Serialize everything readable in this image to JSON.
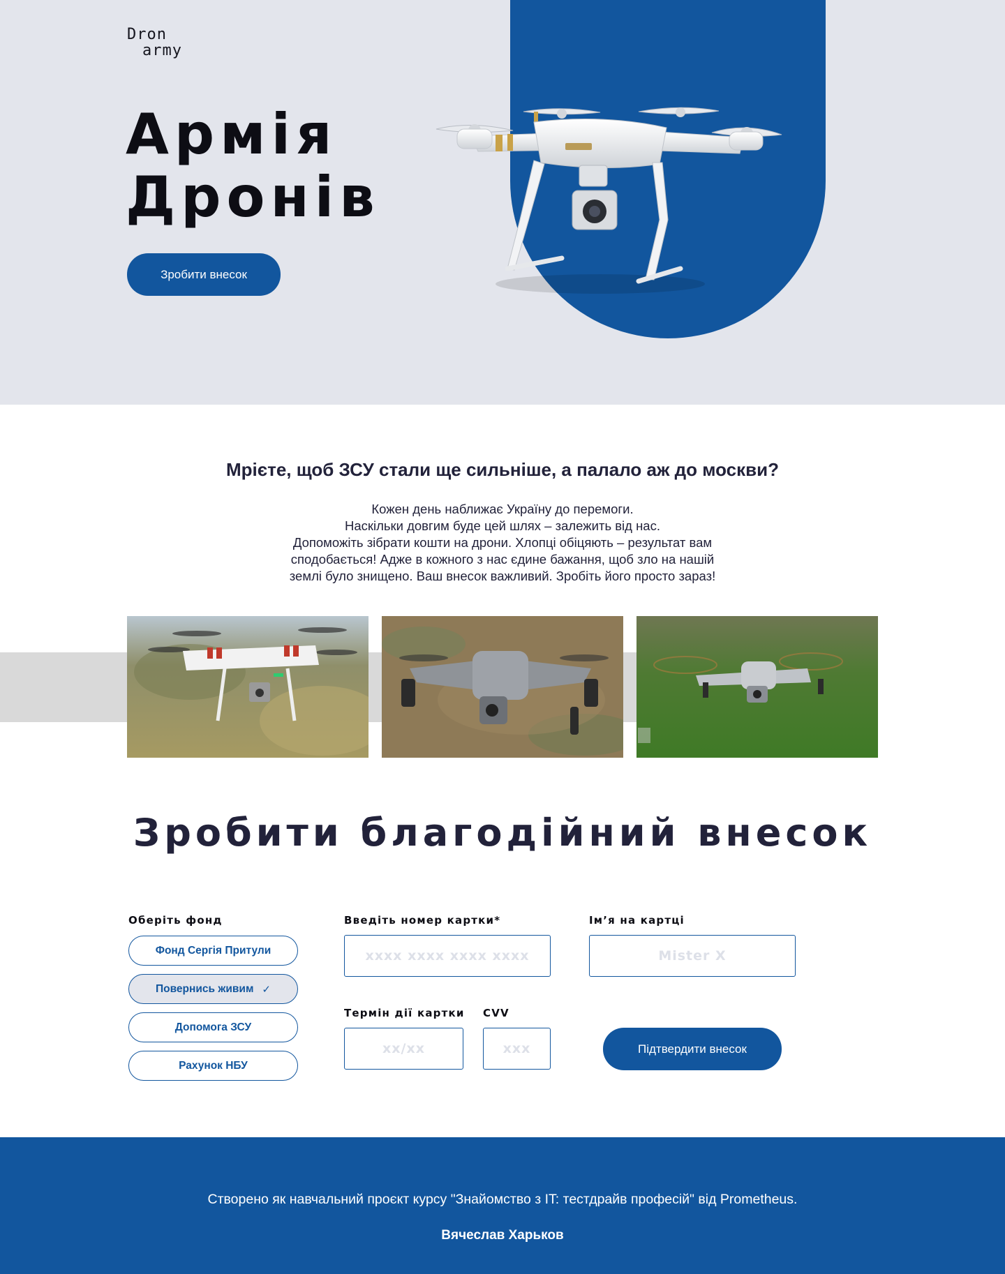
{
  "logo": {
    "line1": "Dron",
    "line2": "army"
  },
  "hero": {
    "title_line1": "Армія",
    "title_line2": "Дронів",
    "cta_label": "Зробити внесок"
  },
  "intro": {
    "title": "Мрієте, щоб ЗСУ стали ще сильніше, а палало аж до москви?",
    "lines": [
      "Кожен день наближає Україну до перемоги.",
      "Наскільки довгим буде цей шлях – залежить від нас.",
      "Допоможіть зібрати кошти на дрони. Хлопці обіцяють – результат вам",
      "сподобається! Адже в кожного з нас єдине бажання, щоб зло на нашій",
      "землі було знищено. Ваш внесок важливий. Зробіть його просто зараз!"
    ]
  },
  "donate": {
    "title": "Зробити благодійний внесок",
    "fund_label": "Оберіть фонд",
    "funds": [
      {
        "label": "Фонд Сергія Притули",
        "selected": false
      },
      {
        "label": "Повернись живим",
        "selected": true
      },
      {
        "label": "Допомога ЗСУ",
        "selected": false
      },
      {
        "label": "Рахунок НБУ",
        "selected": false
      }
    ],
    "card_number_label": "Введіть номер картки*",
    "card_number_placeholder": "xxxx xxxx xxxx xxxx",
    "card_name_label": "Ім’я на картці",
    "card_name_placeholder": "Mister X",
    "expiry_label": "Термін дії картки",
    "expiry_placeholder": "xx/xx",
    "cvv_label": "CVV",
    "cvv_placeholder": "xxx",
    "confirm_label": "Підтвердити внесок"
  },
  "footer": {
    "text": "Створено як навчальний проєкт курсу \"Знайомство з IT: тестдрайв професій\" від Prometheus.",
    "author": "Вячеслав Харьков"
  },
  "colors": {
    "primary": "#12569e",
    "hero_bg": "#e3e5ec",
    "text_dark": "#22223a",
    "gallery_band": "#d9d9d9"
  }
}
